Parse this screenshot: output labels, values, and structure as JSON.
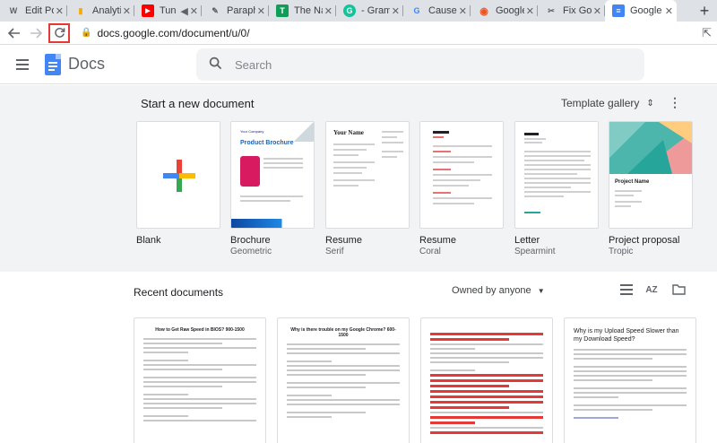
{
  "browser": {
    "tabs": [
      {
        "label": "Edit Pos",
        "icon": "wordpress-icon",
        "color": "#5f6368",
        "glyph": "W"
      },
      {
        "label": "Analytic",
        "icon": "analytics-icon",
        "color": "#f9ab00",
        "glyph": "▮"
      },
      {
        "label": "Tun",
        "icon": "youtube-icon",
        "color": "#ff0000",
        "glyph": "▶"
      },
      {
        "label": "Paraphr",
        "icon": "quill-icon",
        "color": "#5f6368",
        "glyph": "✎"
      },
      {
        "label": "The Nat",
        "icon": "sheets-icon",
        "color": "#0f9d58",
        "glyph": "T"
      },
      {
        "label": "- Gramm",
        "icon": "grammarly-icon",
        "color": "#15c39a",
        "glyph": "G"
      },
      {
        "label": "Causes",
        "icon": "google-icon",
        "color": "#4285f4",
        "glyph": "G"
      },
      {
        "label": "Google",
        "icon": "chrome-icon",
        "color": "#f4511e",
        "glyph": "●"
      },
      {
        "label": "Fix Goo",
        "icon": "tools-icon",
        "color": "#5f6368",
        "glyph": "✂"
      },
      {
        "label": "Google",
        "icon": "docs-icon",
        "color": "#4285f4",
        "glyph": "≡"
      }
    ],
    "new_tab_label": "+",
    "url": "docs.google.com/document/u/0/"
  },
  "docs": {
    "app_title": "Docs",
    "search_placeholder": "Search"
  },
  "templates": {
    "heading": "Start a new document",
    "gallery_label": "Template gallery",
    "items": [
      {
        "name": "Blank",
        "sub": ""
      },
      {
        "name": "Brochure",
        "sub": "Geometric",
        "thumb_title": "Your Company",
        "thumb_heading": "Product Brochure"
      },
      {
        "name": "Resume",
        "sub": "Serif",
        "thumb_title": "Your Name"
      },
      {
        "name": "Resume",
        "sub": "Coral"
      },
      {
        "name": "Letter",
        "sub": "Spearmint"
      },
      {
        "name": "Project proposal",
        "sub": "Tropic",
        "thumb_title": "Project Name"
      }
    ]
  },
  "recent": {
    "heading": "Recent documents",
    "owner_filter": "Owned by anyone",
    "docs": [
      {
        "title": "How to Get Raw Speed in BIOS? 900-1500"
      },
      {
        "title": "Why is there trouble on my Google Chrome? 600-1500"
      },
      {
        "title": ""
      },
      {
        "title": "Why is my Upload Speed Slower than my Download Speed?"
      }
    ]
  }
}
